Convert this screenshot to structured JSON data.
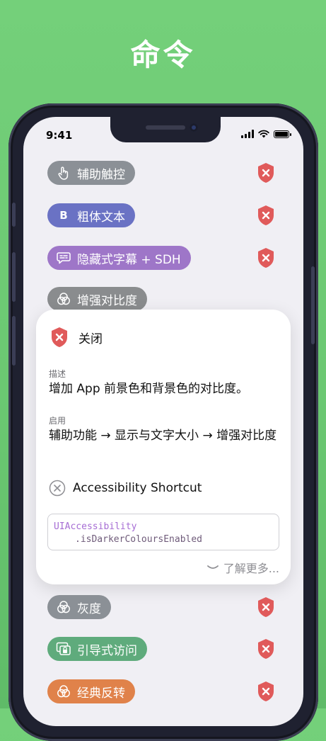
{
  "header_title": "命令",
  "status_bar": {
    "time": "9:41"
  },
  "commands": [
    {
      "label": "辅助触控",
      "icon": "touch-hand-icon",
      "color": "#8b9096"
    },
    {
      "label": "粗体文本",
      "icon": "bold-b-icon",
      "icon_text": "B",
      "color": "#6a72c4"
    },
    {
      "label": "隐藏式字幕 + SDH",
      "icon": "caption-bubble-icon",
      "color": "#9e76c8"
    },
    {
      "label": "增强对比度",
      "icon": "color-circles-icon",
      "color": "#8a8c8e"
    }
  ],
  "detail": {
    "status_label": "关闭",
    "description_heading": "描述",
    "description": "增加 App 前景色和背景色的对比度。",
    "enable_heading": "启用",
    "enable_path": "辅助功能 → 显示与文字大小 → 增强对比度",
    "shortcut_label": "Accessibility Shortcut",
    "code_line1": "UIAccessibility",
    "code_line2": ".isDarkerColoursEnabled",
    "more_label": "了解更多..."
  },
  "commands_after": [
    {
      "label": "灰度",
      "icon": "color-circles-icon",
      "color": "#8b9096"
    },
    {
      "label": "引导式访问",
      "icon": "guided-access-icon",
      "color": "#5fab7c"
    },
    {
      "label": "经典反转",
      "icon": "color-circles-icon",
      "color": "#e0824a"
    }
  ],
  "colors": {
    "shield_red": "#e05a5a",
    "background_green": "#6bc872"
  }
}
